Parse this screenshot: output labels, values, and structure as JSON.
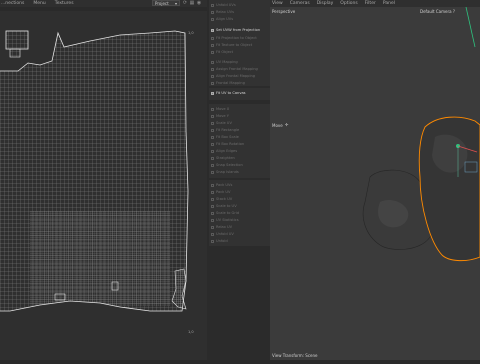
{
  "uv_menu": [
    "...nections",
    "Menu",
    "Textures"
  ],
  "uv_dropdown": {
    "value": "Project"
  },
  "uv_toolbar_icons": [
    "sync-icon",
    "grid-icon",
    "view-icon",
    "pin-icon",
    "settings-icon"
  ],
  "uv_canvas_labels": {
    "top_right": "1,0",
    "bottom_right": "1,0"
  },
  "tool_panel": {
    "top_items": [
      "Unfold UVs",
      "Relax UVs",
      "Align UVs"
    ],
    "projection_items": [
      {
        "label": "Set UVW from Projection",
        "active": true,
        "toggle": true
      },
      {
        "label": "Fit Projection to Object",
        "active": false
      },
      {
        "label": "Fit Texture to Object",
        "active": false
      },
      {
        "label": "Fit Object",
        "active": false
      }
    ],
    "mapping_items": [
      "UV Mapping",
      "Assign Frontal Mapping",
      "Align Frontal Mapping",
      "Frontal Mapping"
    ],
    "canvas_item": {
      "label": "Fit UV to Canvas",
      "active": true,
      "toggle": true
    },
    "transform_items": [
      "Move X",
      "Move Y",
      "Scale UV",
      "Fit Rectangle",
      "Fit Box Scale",
      "Fit Box Rotation",
      "Align Edges",
      "Straighten",
      "Snap Selection",
      "Snap Islands"
    ],
    "pack_items": [
      "Pack UVs",
      "Pack UV",
      "Stack UV",
      "Scale to UV",
      "Scale to Grid",
      "UV Statistics",
      "Relax UV",
      "Unfold UV",
      "Unfold"
    ]
  },
  "viewport_menu": [
    "View",
    "Cameras",
    "Display",
    "Options",
    "Filter",
    "Panel"
  ],
  "viewport": {
    "name": "Perspective",
    "camera": "Default Camera ?",
    "move_label": "Move",
    "status": "View Transform: Scene"
  },
  "colors": {
    "panel_bg": "#2b2b2b",
    "uv_bg": "#2f2f2f",
    "viewport_bg": "#3b3b3b",
    "selection": "#ff8a00"
  }
}
